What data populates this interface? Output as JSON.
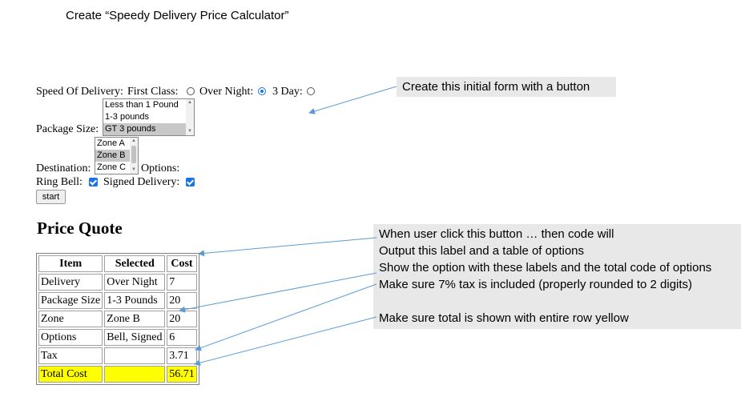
{
  "heading": "Create “Speedy Delivery Price Calculator”",
  "form": {
    "speed_label": "Speed Of Delivery:",
    "speed_options": [
      {
        "label": "First Class:",
        "checked": false
      },
      {
        "label": "Over Night:",
        "checked": true
      },
      {
        "label": "3 Day:",
        "checked": false
      }
    ],
    "package_label": "Package Size:",
    "package_options": [
      "Less than 1 Pound",
      "1-3 pounds",
      "GT 3 pounds"
    ],
    "package_selected": "GT 3 pounds",
    "destination_label": "Destination:",
    "zone_options": [
      "Zone A",
      "Zone B",
      "Zone C"
    ],
    "zone_selected": "Zone B",
    "options_label": "Options:",
    "ring_bell_label": "Ring Bell:",
    "ring_bell_checked": true,
    "signed_label": "Signed Delivery:",
    "signed_checked": true,
    "start_button": "start"
  },
  "quote": {
    "title": "Price Quote",
    "headers": [
      "Item",
      "Selected",
      "Cost"
    ],
    "rows": [
      [
        "Delivery",
        "Over Night",
        "7"
      ],
      [
        "Package Size",
        "1-3 Pounds",
        "20"
      ],
      [
        "Zone",
        "Zone B",
        "20"
      ],
      [
        "Options",
        "Bell, Signed",
        "6"
      ],
      [
        "Tax",
        "",
        "3.71"
      ],
      [
        "Total Cost",
        "",
        "56.71"
      ]
    ],
    "total_row_color": "#ffff00"
  },
  "annotations": {
    "form_note": "Create this initial form with a button",
    "quote_notes": [
      "When user click this button … then code will",
      "Output this label and a table of options",
      "Show the option with these labels and the total code of options",
      "Make sure 7% tax is included (properly rounded to 2 digits)",
      "",
      "Make sure total is shown with entire row yellow"
    ],
    "arrow_color": "#5b9bd5"
  }
}
